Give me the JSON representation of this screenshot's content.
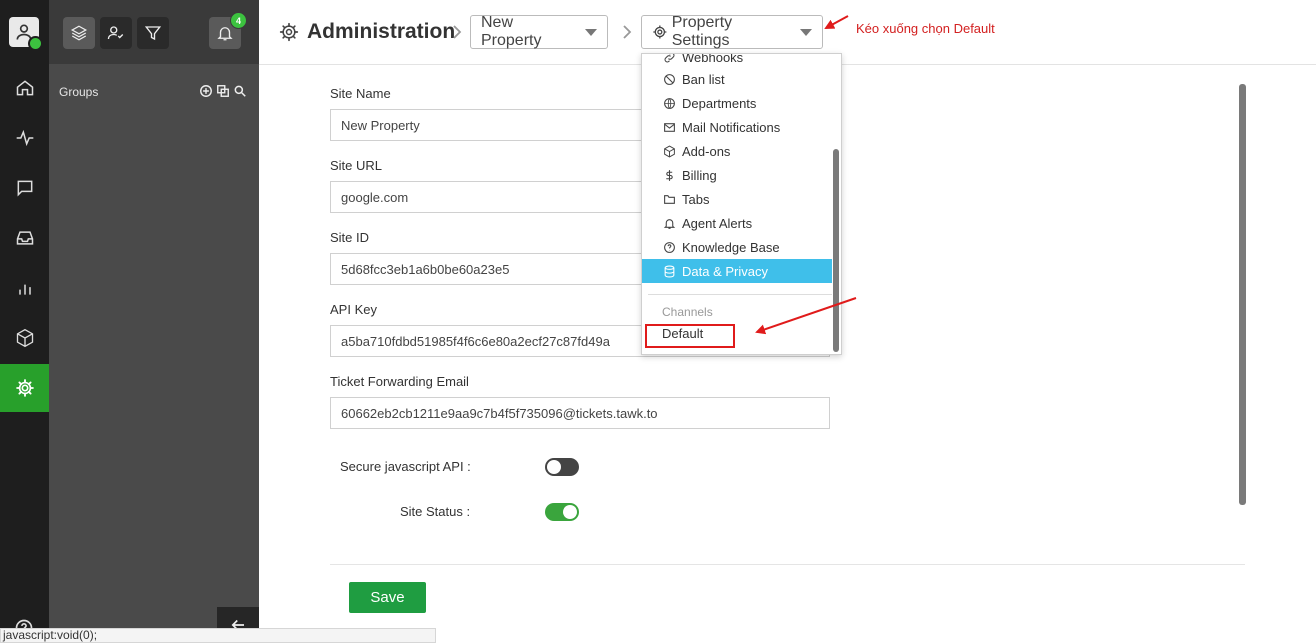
{
  "header": {
    "title": "Administration",
    "property_selector": "New Property",
    "settings_selector": "Property Settings"
  },
  "sidebar": {
    "groups_label": "Groups",
    "notification_count": "4"
  },
  "form": {
    "site_name_label": "Site Name",
    "site_name_value": "New  Property",
    "site_url_label": "Site URL",
    "site_url_value": "google.com",
    "site_id_label": "Site ID",
    "site_id_value": "5d68fcc3eb1a6b0be60a23e5",
    "api_key_label": "API Key",
    "api_key_value": "a5ba710fdbd51985f4f6c6e80a2ecf27c87fd49a",
    "ticket_email_label": "Ticket Forwarding Email",
    "ticket_email_value": "60662eb2cb1211e9aa9c7b4f5f735096@tickets.tawk.to",
    "secure_js_label": "Secure javascript API :",
    "secure_js_on": false,
    "site_status_label": "Site Status :",
    "site_status_on": true,
    "save_label": "Save"
  },
  "dropdown": {
    "items": [
      {
        "label": "Webhooks",
        "icon": "link-icon"
      },
      {
        "label": "Ban list",
        "icon": "ban-icon"
      },
      {
        "label": "Departments",
        "icon": "globe-icon"
      },
      {
        "label": "Mail Notifications",
        "icon": "mail-icon"
      },
      {
        "label": "Add-ons",
        "icon": "box-icon"
      },
      {
        "label": "Billing",
        "icon": "dollar-icon"
      },
      {
        "label": "Tabs",
        "icon": "folder-icon"
      },
      {
        "label": "Agent Alerts",
        "icon": "bell-icon"
      },
      {
        "label": "Knowledge Base",
        "icon": "question-circle-icon"
      },
      {
        "label": "Data & Privacy",
        "icon": "database-icon"
      }
    ],
    "selected_index": 9,
    "channels_header": "Channels",
    "default_channel": "Default"
  },
  "annotation": {
    "text": "Kéo xuống chọn Default"
  },
  "statusbar": {
    "text": "javascript:void(0);"
  },
  "colors": {
    "accent_green": "#28a02b",
    "selection_blue": "#3fbfea",
    "annotation_red": "#d32020"
  }
}
